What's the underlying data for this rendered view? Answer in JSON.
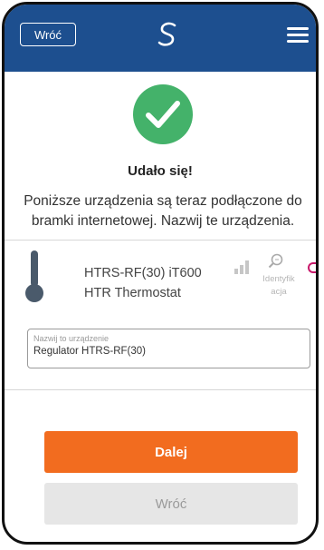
{
  "header": {
    "back_label": "Wróć",
    "logo_icon": "salus-s-logo-icon",
    "menu_icon": "hamburger-menu-icon",
    "bar_color": "#1d4f8f"
  },
  "success": {
    "icon": "checkmark-icon",
    "title": "Udało się!",
    "description": "Poniższe urządzenia są teraz podłączone do bramki internetowej. Nazwij te urządzenia."
  },
  "device": {
    "icon": "thermometer-icon",
    "model": "HTRS-RF(30) iT600",
    "type": "HTR Thermostat",
    "signal_icon": "signal-strength-icon",
    "identify_icon": "magnifier-icon",
    "identify_label_line1": "Identyfik",
    "identify_label_line2": "acja"
  },
  "name_field": {
    "label": "Nazwij to urządzenie",
    "value": "Regulator HTRS-RF(30)"
  },
  "buttons": {
    "next_label": "Dalej",
    "back_label": "Wróć",
    "next_color": "#f26c1f"
  }
}
